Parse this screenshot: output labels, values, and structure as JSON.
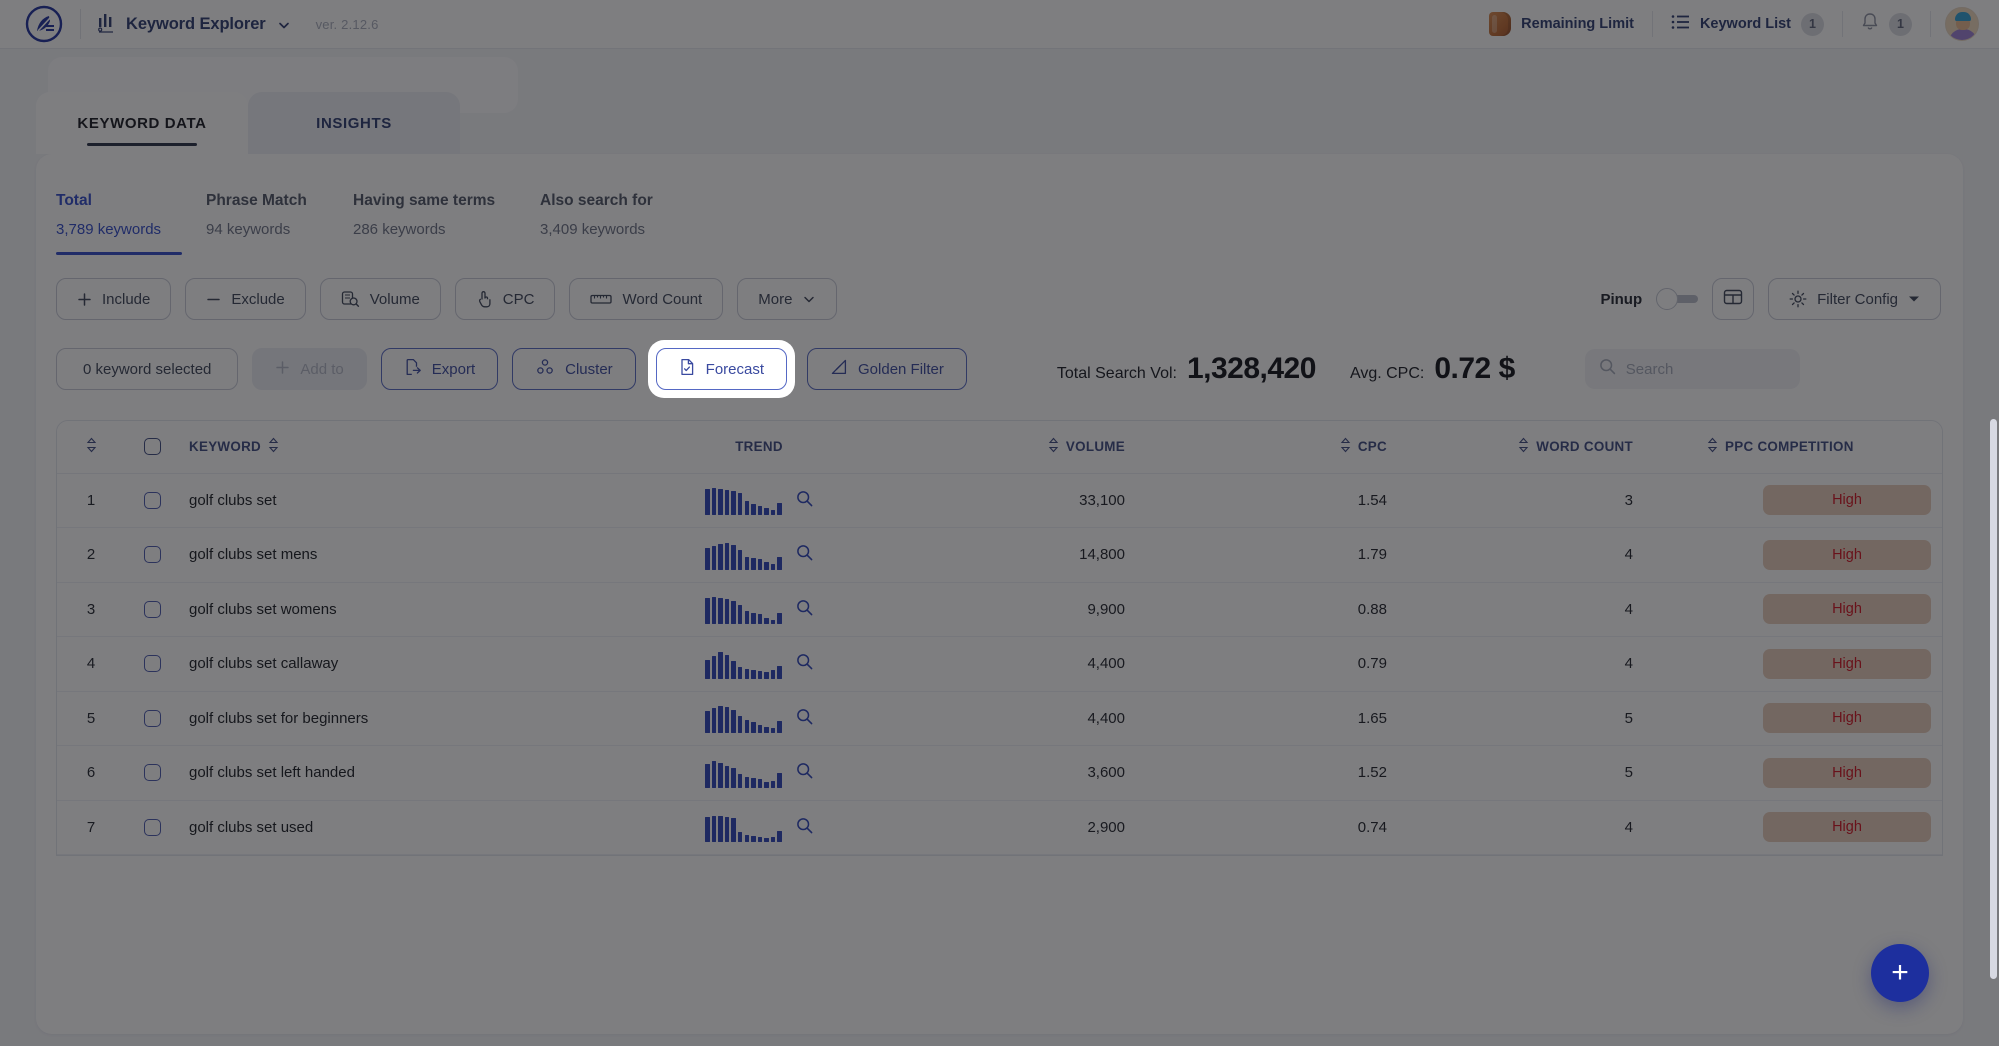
{
  "header": {
    "logo_icon": "feather-pen-logo-icon",
    "app_switcher_icon": "bar-chart-icon",
    "app_title": "Keyword Explorer",
    "chevron_icon": "chevron-down-icon",
    "version": "ver. 2.12.6",
    "remaining_limit": {
      "label": "Remaining Limit",
      "icon": "coin-icon"
    },
    "keyword_list": {
      "label": "Keyword List",
      "icon": "list-icon",
      "badge": "1"
    },
    "notifications": {
      "icon": "bell-icon",
      "badge": "1"
    },
    "avatar": "user-avatar"
  },
  "tabs": [
    {
      "label": "KEYWORD DATA",
      "active": true
    },
    {
      "label": "INSIGHTS",
      "active": false
    }
  ],
  "stats": [
    {
      "title": "Total",
      "value": "3,789 keywords",
      "active": true
    },
    {
      "title": "Phrase Match",
      "value": "94 keywords",
      "active": false
    },
    {
      "title": "Having same terms",
      "value": "286 keywords",
      "active": false
    },
    {
      "title": "Also search for",
      "value": "3,409 keywords",
      "active": false
    }
  ],
  "filters": [
    {
      "label": "Include",
      "icon": "plus-icon"
    },
    {
      "label": "Exclude",
      "icon": "minus-icon"
    },
    {
      "label": "Volume",
      "icon": "volume-search-icon"
    },
    {
      "label": "CPC",
      "icon": "click-hand-icon"
    },
    {
      "label": "Word Count",
      "icon": "ruler-icon"
    },
    {
      "label": "More",
      "icon": "chevron-down-icon"
    }
  ],
  "filters_right": {
    "pinup_label": "Pinup",
    "pinup_on": false,
    "layout_button_icon": "columns-layout-icon",
    "filter_config_label": "Filter Config",
    "filter_config_icon": "gear-icon",
    "filter_config_caret": "caret-down-icon"
  },
  "toolbar": {
    "selected_label": "0 keyword selected",
    "add_to_label": "Add to",
    "add_to_icon": "plus-icon",
    "export_label": "Export",
    "export_icon": "export-file-icon",
    "cluster_label": "Cluster",
    "cluster_icon": "cluster-nodes-icon",
    "forecast_label": "Forecast",
    "forecast_icon": "forecast-document-icon",
    "golden_filter_label": "Golden Filter",
    "golden_filter_icon": "golden-filter-icon",
    "total_search_vol_label": "Total Search Vol:",
    "total_search_vol_value": "1,328,420",
    "avg_cpc_label": "Avg. CPC:",
    "avg_cpc_value": "0.72 $",
    "search_placeholder": "Search",
    "search_value": "",
    "search_icon": "search-icon"
  },
  "table": {
    "columns": [
      {
        "key": "idx",
        "label": "",
        "sortable": true
      },
      {
        "key": "chk",
        "label": "",
        "sortable": false
      },
      {
        "key": "keyword",
        "label": "KEYWORD",
        "sortable": true
      },
      {
        "key": "trend",
        "label": "TREND",
        "sortable": false
      },
      {
        "key": "volume",
        "label": "VOLUME",
        "sortable": true
      },
      {
        "key": "cpc",
        "label": "CPC",
        "sortable": true
      },
      {
        "key": "word_count",
        "label": "WORD COUNT",
        "sortable": true
      },
      {
        "key": "ppc",
        "label": "PPC COMPETITION",
        "sortable": true
      }
    ],
    "rows": [
      {
        "idx": "1",
        "keyword": "golf clubs set",
        "volume": "33,100",
        "cpc": "1.54",
        "word_count": "3",
        "ppc": "High",
        "trend": [
          26,
          27,
          26,
          25,
          24,
          22,
          14,
          11,
          9,
          7,
          5,
          12
        ]
      },
      {
        "idx": "2",
        "keyword": "golf clubs set mens",
        "volume": "14,800",
        "cpc": "1.79",
        "word_count": "4",
        "ppc": "High",
        "trend": [
          22,
          24,
          26,
          27,
          25,
          20,
          13,
          12,
          11,
          8,
          6,
          13
        ]
      },
      {
        "idx": "3",
        "keyword": "golf clubs set womens",
        "volume": "9,900",
        "cpc": "0.88",
        "word_count": "4",
        "ppc": "High",
        "trend": [
          26,
          27,
          26,
          25,
          23,
          19,
          13,
          11,
          10,
          6,
          4,
          11
        ]
      },
      {
        "idx": "4",
        "keyword": "golf clubs set callaway",
        "volume": "4,400",
        "cpc": "0.79",
        "word_count": "4",
        "ppc": "High",
        "trend": [
          19,
          23,
          27,
          24,
          18,
          12,
          10,
          9,
          8,
          7,
          9,
          13
        ]
      },
      {
        "idx": "5",
        "keyword": "golf clubs set for beginners",
        "volume": "4,400",
        "cpc": "1.65",
        "word_count": "5",
        "ppc": "High",
        "trend": [
          22,
          25,
          27,
          26,
          23,
          17,
          13,
          11,
          8,
          6,
          5,
          12
        ]
      },
      {
        "idx": "6",
        "keyword": "golf clubs set left handed",
        "volume": "3,600",
        "cpc": "1.52",
        "word_count": "5",
        "ppc": "High",
        "trend": [
          24,
          27,
          25,
          22,
          20,
          14,
          11,
          10,
          9,
          6,
          7,
          15
        ]
      },
      {
        "idx": "7",
        "keyword": "golf clubs set used",
        "volume": "2,900",
        "cpc": "0.74",
        "word_count": "4",
        "ppc": "High",
        "trend": [
          25,
          26,
          26,
          25,
          24,
          10,
          7,
          6,
          5,
          4,
          5,
          11
        ]
      }
    ]
  },
  "fab": {
    "icon": "plus-icon",
    "label": "+"
  },
  "colors": {
    "accent_blue": "#2f49c9",
    "nav_navy": "#2c3a70",
    "spark_blue": "#2a43bb",
    "badge_bg": "#e7cdbb",
    "badge_text": "#d0111f",
    "fab_bg": "#1d2f9e"
  }
}
